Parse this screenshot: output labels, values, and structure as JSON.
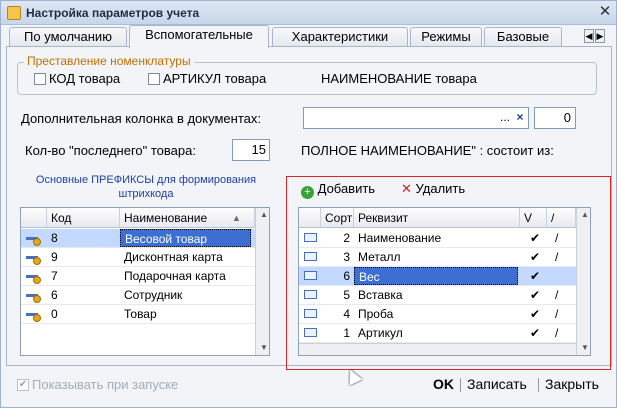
{
  "window": {
    "title": "Настройка параметров учета"
  },
  "tabs": [
    "По умолчанию",
    "Вспомогательные",
    "Характеристики",
    "Режимы",
    "Базовые"
  ],
  "group": {
    "title": "Преставление номенклатуры",
    "kod_label": "КОД товара",
    "articul_label": "АРТИКУЛ товара",
    "name_label": "НАИМЕНОВАНИЕ товара"
  },
  "extra_column": {
    "label": "Дополнительная колонка в документах:",
    "value": "",
    "ellipsis": "...",
    "clear": "×",
    "count": "0"
  },
  "last_count": {
    "label": "Кол-во \"последнего\" товара:",
    "value": "15"
  },
  "full_name_label": "ПОЛНОЕ НАИМЕНОВАНИЕ\" : состоит из:",
  "prefixes": {
    "label": "Основные ПРЕФИКСЫ для формирования штрихкода",
    "columns": [
      "Код",
      "Наименование"
    ],
    "rows": [
      {
        "code": "8",
        "name": "Весовой  товар"
      },
      {
        "code": "9",
        "name": "Дисконтная карта"
      },
      {
        "code": "7",
        "name": "Подарочная карта"
      },
      {
        "code": "6",
        "name": "Сотрудник"
      },
      {
        "code": "0",
        "name": "Товар"
      }
    ]
  },
  "toolbar": {
    "add": "Добавить",
    "delete": "Удалить"
  },
  "requisites": {
    "columns": [
      "Сорт",
      "Реквизит",
      "V",
      "/"
    ],
    "rows": [
      {
        "sort": "2",
        "name": "Наименование",
        "v": "✔",
        "slash": "/"
      },
      {
        "sort": "3",
        "name": "Металл",
        "v": "✔",
        "slash": "/"
      },
      {
        "sort": "6",
        "name": "Вес",
        "v": "✔",
        "slash": ""
      },
      {
        "sort": "5",
        "name": "Вставка",
        "v": "✔",
        "slash": "/"
      },
      {
        "sort": "4",
        "name": "Проба",
        "v": "✔",
        "slash": "/"
      },
      {
        "sort": "1",
        "name": "Артикул",
        "v": "✔",
        "slash": "/"
      }
    ]
  },
  "show_on_start": "Показывать при запуске",
  "buttons": {
    "ok": "OK",
    "save": "Записать",
    "close": "Закрыть"
  }
}
